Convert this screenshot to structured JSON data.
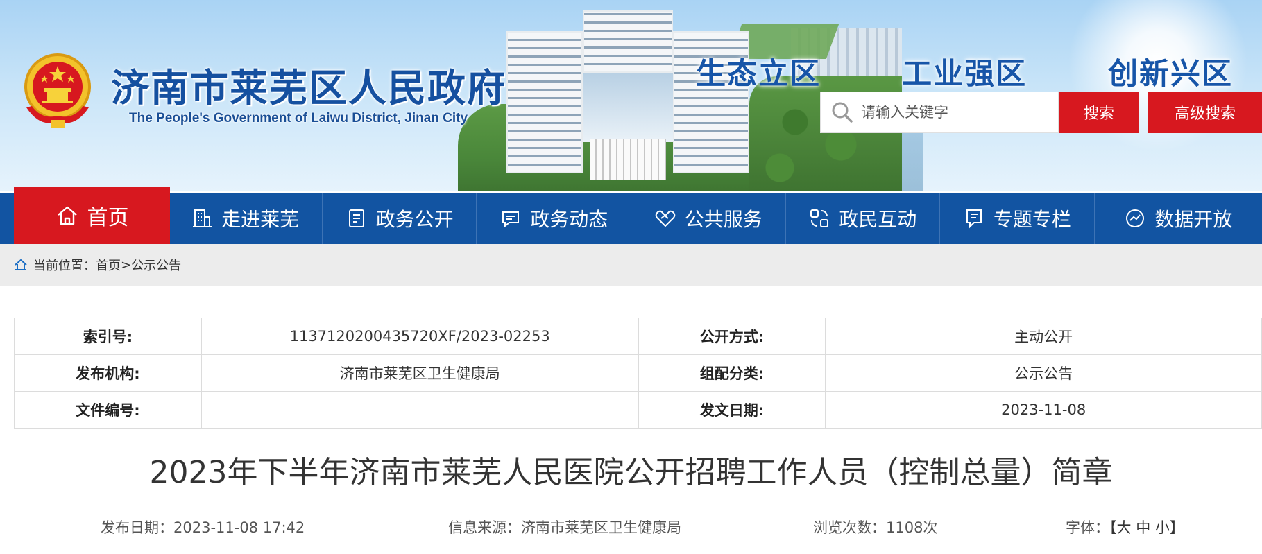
{
  "header": {
    "title": "济南市莱芜区人民政府",
    "subtitle": "The People's Government of Laiwu District, Jinan City",
    "slogans": [
      "生态立区",
      "工业强区",
      "创新兴区"
    ],
    "search": {
      "placeholder": "请输入关键字",
      "search_label": "搜索",
      "advanced_label": "高级搜索"
    }
  },
  "colors": {
    "nav_blue": "#1254a2",
    "accent_red": "#d7181f",
    "title_blue": "#1550a0"
  },
  "nav": {
    "home": {
      "label": "首页",
      "icon": "home-icon"
    },
    "items": [
      {
        "label": "走进莱芜",
        "icon": "building-icon"
      },
      {
        "label": "政务公开",
        "icon": "document-icon"
      },
      {
        "label": "政务动态",
        "icon": "chat-icon"
      },
      {
        "label": "公共服务",
        "icon": "handshake-icon"
      },
      {
        "label": "政民互动",
        "icon": "interaction-icon"
      },
      {
        "label": "专题专栏",
        "icon": "topic-icon"
      },
      {
        "label": "数据开放",
        "icon": "data-icon"
      }
    ]
  },
  "breadcrumb": {
    "prefix": "当前位置：",
    "home": "首页",
    "separator": ">",
    "current": "公示公告"
  },
  "meta": {
    "rows": [
      [
        {
          "k": "索引号:",
          "v": "11371202004357​20XF/2023-02253"
        },
        {
          "k": "公开方式:",
          "v": "主动公开"
        }
      ],
      [
        {
          "k": "发布机构:",
          "v": "济南市莱芜区卫生健康局"
        },
        {
          "k": "组配分类:",
          "v": "公示公告"
        }
      ],
      [
        {
          "k": "文件编号:",
          "v": ""
        },
        {
          "k": "发文日期:",
          "v": "2023-11-08"
        }
      ]
    ]
  },
  "article": {
    "title": "2023年下半年济南市莱芜人民医院公开招聘工作人员（控制总量）简章",
    "publish_date": "发布日期：2023-11-08 17:42",
    "source": "信息来源：济南市莱芜区卫生健康局",
    "views": "浏览次数：1108次",
    "font_label": "字体：",
    "font_open": "【",
    "font_large": "大",
    "font_medium": "中",
    "font_small": "小",
    "font_close": "】"
  }
}
